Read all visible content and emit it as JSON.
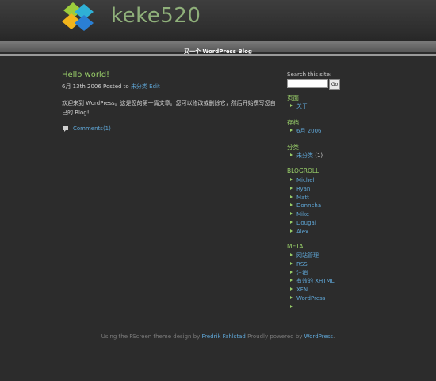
{
  "header": {
    "site_title": "keke520",
    "tagline": "又一个 WordPress Blog",
    "logo_colors": [
      "#9ccc3c",
      "#f2b51c",
      "#2a7fd4",
      "#2fb0d6"
    ]
  },
  "post": {
    "title": "Hello world!",
    "date": "6月 13th 2006",
    "posted_to": "Posted to",
    "category": "未分类",
    "edit": "Edit",
    "body": "欢迎来到 WordPress。这是您的第一篇文章。您可以修改或删除它，然后开始撰写您自己的 Blog!",
    "comments": "Comments(1)"
  },
  "sidebar": {
    "search_label": "Search this site:",
    "search_value": "",
    "search_button": "Go",
    "pages_title": "页面",
    "pages": [
      "关于"
    ],
    "archives_title": "存档",
    "archives": [
      "6月 2006"
    ],
    "categories_title": "分类",
    "categories": [
      {
        "name": "未分类",
        "count": "(1)"
      }
    ],
    "blogroll_title": "BLOGROLL",
    "blogroll": [
      "Michel",
      "Ryan",
      "Matt",
      "Donncha",
      "Mike",
      "Dougal",
      "Alex"
    ],
    "meta_title": "META",
    "meta": [
      "网站管理",
      "RSS",
      "注销",
      "有效的 XHTML",
      "XFN",
      "WordPress",
      ""
    ]
  },
  "footer": {
    "text1": "Using the FScreen theme design by",
    "author": "Fredrik Fahlstad",
    "text2": "Proudly powered by",
    "powered": "WordPress",
    "dot": "."
  }
}
